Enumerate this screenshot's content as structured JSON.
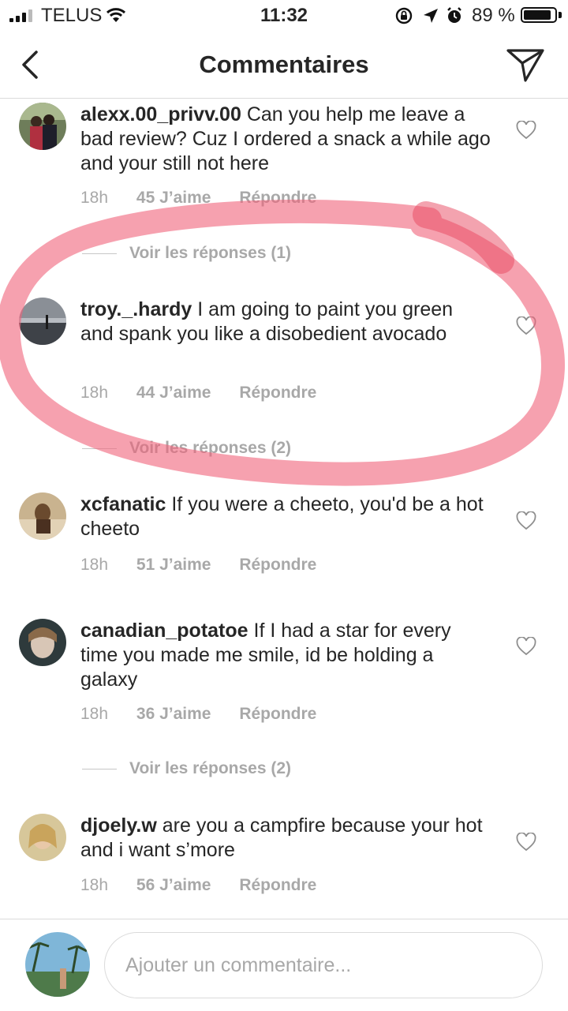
{
  "status_bar": {
    "carrier": "TELUS",
    "time": "11:32",
    "battery_pct": "89 %",
    "battery_level": 0.89
  },
  "nav": {
    "title": "Commentaires"
  },
  "comments": [
    {
      "username": "alexx.00_privv.00",
      "text": "Can you help me leave a bad review? Cuz I ordered a snack a while ago and your still not here",
      "time": "18h",
      "likes": "45 J’aime",
      "reply": "Répondre",
      "view_replies": "Voir les réponses (1)"
    },
    {
      "username": "troy._.hardy",
      "text": "I am going to paint you green and spank you like a disobedient avocado",
      "time": "18h",
      "likes": "44 J’aime",
      "reply": "Répondre",
      "view_replies": "Voir les réponses (2)"
    },
    {
      "username": "xcfanatic",
      "text": "If you were a cheeto, you'd be a hot cheeto",
      "time": "18h",
      "likes": "51 J’aime",
      "reply": "Répondre"
    },
    {
      "username": "canadian_potatoe",
      "text": "If I had a star for every time you made me smile, id be holding a galaxy",
      "time": "18h",
      "likes": "36 J’aime",
      "reply": "Répondre",
      "view_replies": "Voir les réponses (2)"
    },
    {
      "username": "djoely.w",
      "text": "are you a campfire because your hot and i want s’more",
      "time": "18h",
      "likes": "56 J’aime",
      "reply": "Répondre"
    }
  ],
  "composer": {
    "placeholder": "Ajouter un commentaire..."
  },
  "colors": {
    "text": "#262626",
    "meta": "#a8a8a8",
    "highlight": "#f0637a"
  }
}
